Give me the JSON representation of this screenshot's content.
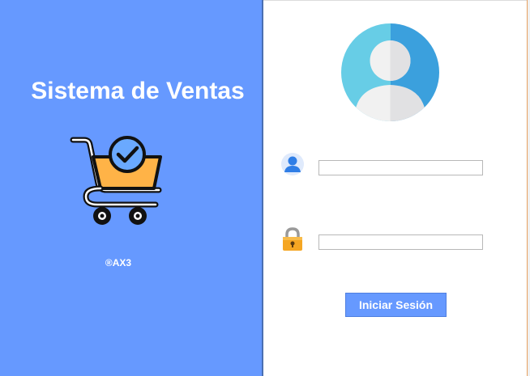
{
  "brand": {
    "title": "Sistema de Ventas",
    "copyright": "®AX3",
    "logo_icon": "shopping-cart-check-icon",
    "panel_color": "#6699ff"
  },
  "login": {
    "avatar_icon": "user-avatar-icon",
    "username_icon": "user-icon",
    "username_value": "",
    "password_icon": "padlock-icon",
    "password_value": "",
    "submit_label": "Iniciar Sesión",
    "button_color": "#6699ff"
  }
}
